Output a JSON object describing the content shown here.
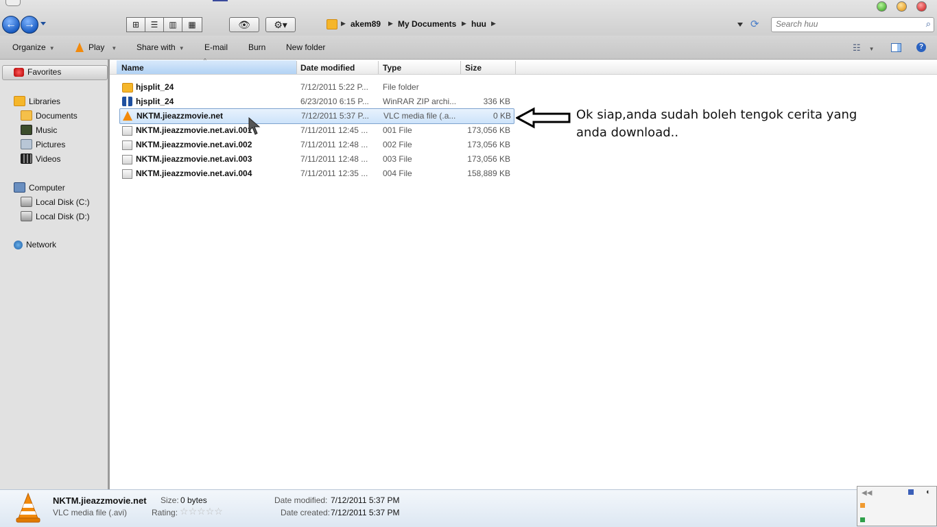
{
  "nav": {
    "back_glyph": "←",
    "forward_glyph": "→"
  },
  "breadcrumb": [
    "akem89",
    "My Documents",
    "huu"
  ],
  "search": {
    "placeholder": "Search huu"
  },
  "commands": {
    "organize": "Organize",
    "play": "Play",
    "share_with": "Share with",
    "email": "E-mail",
    "burn": "Burn",
    "new_folder": "New folder"
  },
  "sidebar": {
    "favorites": "Favorites",
    "libraries": "Libraries",
    "library_items": [
      "Documents",
      "Music",
      "Pictures",
      "Videos"
    ],
    "computer": "Computer",
    "disks": [
      "Local Disk (C:)",
      "Local Disk (D:)"
    ],
    "network": "Network"
  },
  "columns": {
    "name": "Name",
    "date": "Date modified",
    "type": "Type",
    "size": "Size"
  },
  "files": [
    {
      "name": "hjsplit_24",
      "date": "7/12/2011 5:22 P...",
      "type": "File folder",
      "size": "",
      "icon": "folder-icon"
    },
    {
      "name": "hjsplit_24",
      "date": "6/23/2010 6:15 P...",
      "type": "WinRAR ZIP archi...",
      "size": "336 KB",
      "icon": "winrar-icon"
    },
    {
      "name": "NKTM.jieazzmovie.net",
      "date": "7/12/2011 5:37 P...",
      "type": "VLC media file (.a...",
      "size": "0 KB",
      "icon": "vlc-icon",
      "selected": true
    },
    {
      "name": "NKTM.jieazzmovie.net.avi.001",
      "date": "7/11/2011 12:45 ...",
      "type": "001 File",
      "size": "173,056 KB",
      "icon": "file-icon"
    },
    {
      "name": "NKTM.jieazzmovie.net.avi.002",
      "date": "7/11/2011 12:48 ...",
      "type": "002 File",
      "size": "173,056 KB",
      "icon": "file-icon"
    },
    {
      "name": "NKTM.jieazzmovie.net.avi.003",
      "date": "7/11/2011 12:48 ...",
      "type": "003 File",
      "size": "173,056 KB",
      "icon": "file-icon"
    },
    {
      "name": "NKTM.jieazzmovie.net.avi.004",
      "date": "7/11/2011 12:35 ...",
      "type": "004 File",
      "size": "158,889 KB",
      "icon": "file-icon"
    }
  ],
  "annotation": "Ok siap,anda sudah boleh tengok cerita yang anda download..",
  "details": {
    "filename": "NKTM.jieazzmovie.net",
    "filetype": "VLC media file (.avi)",
    "size_label": "Size:",
    "size_value": "0 bytes",
    "rating_label": "Rating:",
    "rating_value": 0,
    "modified_label": "Date modified:",
    "modified_value": "7/12/2011 5:37 PM",
    "created_label": "Date created:",
    "created_value": "7/12/2011 5:37 PM"
  },
  "colors": {
    "accent": "#1d5fc4",
    "selection": "#cde3fa",
    "folder": "#f5b62a",
    "vlc": "#f28a0c"
  }
}
